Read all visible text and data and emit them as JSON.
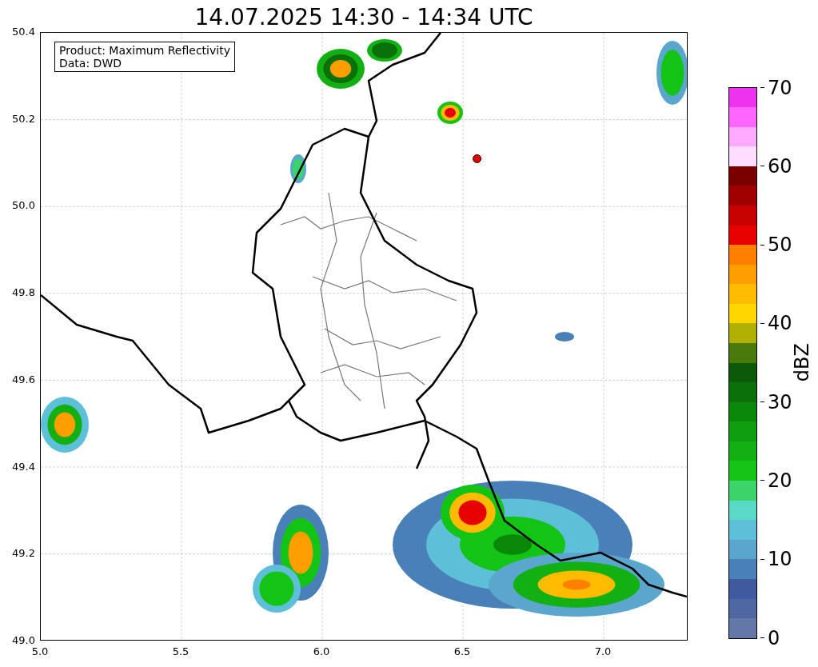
{
  "title": "14.07.2025 14:30 - 14:34 UTC",
  "info_box": [
    "Product: Maximum Reflectivity",
    "Data: DWD"
  ],
  "map": {
    "x_ticks": [
      "5.0",
      "5.5",
      "6.0",
      "6.5",
      "7.0"
    ],
    "y_ticks": [
      "50.4",
      "50.2",
      "50.0",
      "49.8",
      "49.6",
      "49.4",
      "49.2",
      "49.0"
    ]
  },
  "colorbar": {
    "label": "dBZ",
    "ticks": [
      "70",
      "60",
      "50",
      "40",
      "30",
      "20",
      "10",
      "0"
    ],
    "bins": [
      {
        "color": "#ee33ee"
      },
      {
        "color": "#ff66ff"
      },
      {
        "color": "#ffaaff"
      },
      {
        "color": "#ffddff"
      },
      {
        "color": "#7a0000"
      },
      {
        "color": "#a00000"
      },
      {
        "color": "#c80000"
      },
      {
        "color": "#e60000"
      },
      {
        "color": "#ff8000"
      },
      {
        "color": "#ff9e00"
      },
      {
        "color": "#ffbb00"
      },
      {
        "color": "#ffd700"
      },
      {
        "color": "#b0b000"
      },
      {
        "color": "#4a7a0a"
      },
      {
        "color": "#0a5a0a"
      },
      {
        "color": "#0a700a"
      },
      {
        "color": "#0a880a"
      },
      {
        "color": "#0e9e0e"
      },
      {
        "color": "#12b012"
      },
      {
        "color": "#14c414"
      },
      {
        "color": "#3cd46a"
      },
      {
        "color": "#5ad8c8"
      },
      {
        "color": "#5ec0d8"
      },
      {
        "color": "#5aa6cc"
      },
      {
        "color": "#4a80b8"
      },
      {
        "color": "#405aa0"
      },
      {
        "color": "#4e68a4"
      },
      {
        "color": "#6478a8"
      }
    ]
  }
}
